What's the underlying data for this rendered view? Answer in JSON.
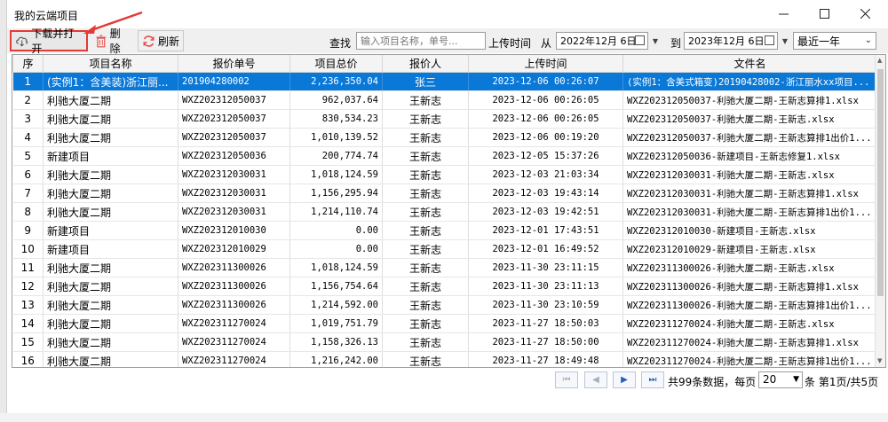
{
  "window": {
    "title": "我的云端项目"
  },
  "toolbar": {
    "download_label": "下载并打开",
    "delete_label": "删除",
    "refresh_label": "刷新",
    "search_label": "查找",
    "search_placeholder": "输入项目名称，单号...",
    "upload_time_label": "上传时间",
    "from_label": "从",
    "from_date": "2022年12月 6日",
    "to_label": "到",
    "to_date": "2023年12月 6日",
    "range_value": "最近一年"
  },
  "table": {
    "columns": [
      "序",
      "项目名称",
      "报价单号",
      "项目总价",
      "报价人",
      "上传时间",
      "文件名"
    ],
    "rows": [
      [
        "1",
        "(实例1：含美装)浙江丽...",
        "201904280002",
        "2,236,350.04",
        "张三",
        "2023-12-06 00:26:07",
        "(实例1：含美式箱变)20190428002-浙江丽水xx项目..."
      ],
      [
        "2",
        "利驰大厦二期",
        "WXZ202312050037",
        "962,037.64",
        "王新志",
        "2023-12-06 00:26:05",
        "WXZ202312050037-利驰大厦二期-王新志算排1.xlsx"
      ],
      [
        "3",
        "利驰大厦二期",
        "WXZ202312050037",
        "830,534.23",
        "王新志",
        "2023-12-06 00:26:05",
        "WXZ202312050037-利驰大厦二期-王新志.xlsx"
      ],
      [
        "4",
        "利驰大厦二期",
        "WXZ202312050037",
        "1,010,139.52",
        "王新志",
        "2023-12-06 00:19:20",
        "WXZ202312050037-利驰大厦二期-王新志算排1出价1..."
      ],
      [
        "5",
        "新建项目",
        "WXZ202312050036",
        "200,774.74",
        "王新志",
        "2023-12-05 15:37:26",
        "WXZ202312050036-新建项目-王新志修复1.xlsx"
      ],
      [
        "6",
        "利驰大厦二期",
        "WXZ202312030031",
        "1,018,124.59",
        "王新志",
        "2023-12-03 21:03:34",
        "WXZ202312030031-利驰大厦二期-王新志.xlsx"
      ],
      [
        "7",
        "利驰大厦二期",
        "WXZ202312030031",
        "1,156,295.94",
        "王新志",
        "2023-12-03 19:43:14",
        "WXZ202312030031-利驰大厦二期-王新志算排1.xlsx"
      ],
      [
        "8",
        "利驰大厦二期",
        "WXZ202312030031",
        "1,214,110.74",
        "王新志",
        "2023-12-03 19:42:51",
        "WXZ202312030031-利驰大厦二期-王新志算排1出价1..."
      ],
      [
        "9",
        "新建项目",
        "WXZ202312010030",
        "0.00",
        "王新志",
        "2023-12-01 17:43:51",
        "WXZ202312010030-新建项目-王新志.xlsx"
      ],
      [
        "10",
        "新建项目",
        "WXZ202312010029",
        "0.00",
        "王新志",
        "2023-12-01 16:49:52",
        "WXZ202312010029-新建项目-王新志.xlsx"
      ],
      [
        "11",
        "利驰大厦二期",
        "WXZ202311300026",
        "1,018,124.59",
        "王新志",
        "2023-11-30 23:11:15",
        "WXZ202311300026-利驰大厦二期-王新志.xlsx"
      ],
      [
        "12",
        "利驰大厦二期",
        "WXZ202311300026",
        "1,156,754.64",
        "王新志",
        "2023-11-30 23:11:13",
        "WXZ202311300026-利驰大厦二期-王新志算排1.xlsx"
      ],
      [
        "13",
        "利驰大厦二期",
        "WXZ202311300026",
        "1,214,592.00",
        "王新志",
        "2023-11-30 23:10:59",
        "WXZ202311300026-利驰大厦二期-王新志算排1出价1..."
      ],
      [
        "14",
        "利驰大厦二期",
        "WXZ202311270024",
        "1,019,751.79",
        "王新志",
        "2023-11-27 18:50:03",
        "WXZ202311270024-利驰大厦二期-王新志.xlsx"
      ],
      [
        "15",
        "利驰大厦二期",
        "WXZ202311270024",
        "1,158,326.13",
        "王新志",
        "2023-11-27 18:50:00",
        "WXZ202311270024-利驰大厦二期-王新志算排1.xlsx"
      ],
      [
        "16",
        "利驰大厦二期",
        "WXZ202311270024",
        "1,216,242.00",
        "王新志",
        "2023-11-27 18:49:48",
        "WXZ202311270024-利驰大厦二期-王新志算排1出价1..."
      ]
    ]
  },
  "pager": {
    "summary": "共99条数据，每页",
    "page_size": "20",
    "page_info": "条 第1页/共5页"
  },
  "colors": {
    "selected_row": "#0a78d7",
    "highlight_border": "#e53935",
    "annotation_arrow": "#e53935"
  },
  "icons": [
    "cloud-download-icon",
    "trash-icon",
    "refresh-icon",
    "calendar-icon",
    "chevron-down-icon",
    "first-page-icon",
    "prev-page-icon",
    "next-page-icon",
    "last-page-icon"
  ]
}
